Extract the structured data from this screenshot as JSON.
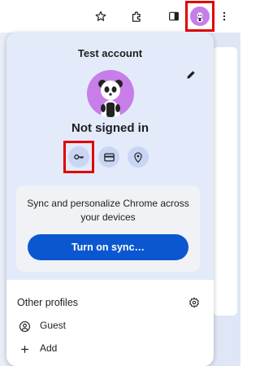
{
  "toolbar": {
    "icons": [
      "star-icon",
      "extensions-icon",
      "side-panel-icon",
      "profile-avatar-icon",
      "more-vert-icon"
    ]
  },
  "popup": {
    "account_title": "Test account",
    "status": "Not signed in",
    "autofill_icons": [
      "key-icon",
      "credit-card-icon",
      "location-pin-icon"
    ],
    "sync": {
      "description": "Sync and personalize Chrome across your devices",
      "button_label": "Turn on sync…"
    },
    "other_profiles": {
      "title": "Other profiles",
      "items": [
        {
          "label": "Guest",
          "icon": "person-icon"
        },
        {
          "label": "Add",
          "icon": "plus-icon"
        }
      ]
    }
  },
  "colors": {
    "header_bg": "#e3ebfb",
    "accent": "#0b57d0",
    "avatar": "#c77ee8",
    "highlight": "#e00000",
    "chip_bg": "#c8d6f4"
  }
}
